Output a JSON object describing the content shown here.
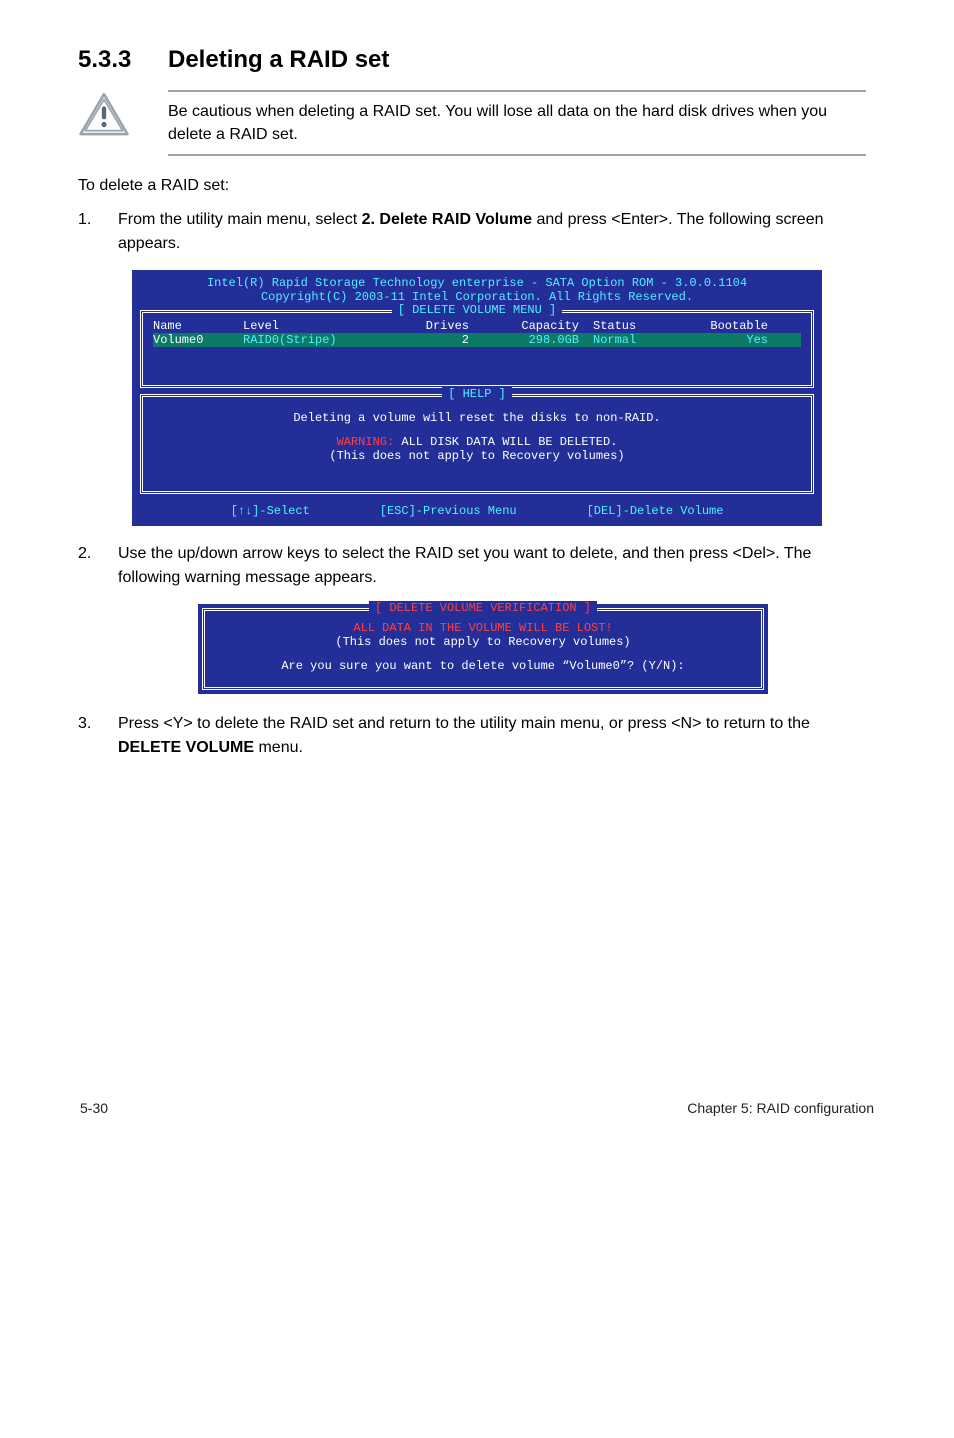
{
  "heading": {
    "number": "5.3.3",
    "title": "Deleting a RAID set"
  },
  "callout": "Be cautious when deleting a RAID set. You will lose all data on the hard disk drives when you delete a RAID set.",
  "intro": "To delete a RAID set:",
  "steps": {
    "1": {
      "num": "1.",
      "pre": "From the utility main menu, select ",
      "bold": "2. Delete RAID Volume",
      "post": " and press <Enter>. The following screen appears."
    },
    "2": {
      "num": "2.",
      "text": "Use the up/down arrow keys to select the RAID set you want to delete, and then press <Del>. The following warning message appears."
    },
    "3": {
      "num": "3.",
      "pre": "Press <Y> to delete the RAID set and return to the utility main menu, or press <N> to return to the ",
      "bold": "DELETE VOLUME",
      "post": " menu."
    }
  },
  "bios": {
    "header1": "Intel(R) Rapid Storage Technology enterprise - SATA Option ROM - 3.0.0.1104",
    "header2": "Copyright(C) 2003-11 Intel Corporation.  All Rights Reserved.",
    "box1": {
      "title": "[ DELETE VOLUME MENU ]",
      "cols": {
        "name": "Name",
        "level": "Level",
        "drives": "Drives",
        "capacity": "Capacity",
        "status": "Status",
        "bootable": "Bootable"
      },
      "row": {
        "name": "Volume0",
        "level": "RAID0(Stripe)",
        "drives": "2",
        "capacity": "298.0GB",
        "status": "Normal",
        "bootable": "Yes"
      }
    },
    "box2": {
      "title": "[ HELP ]",
      "line1": "Deleting a volume will reset the disks to non-RAID.",
      "warn": "WARNING:",
      "warn_rest": " ALL DISK DATA WILL BE DELETED.",
      "line3": "(This does not apply to Recovery volumes)"
    },
    "footer": {
      "a": "[↑↓]-Select",
      "b": "[ESC]-Previous Menu",
      "c": "[DEL]-Delete Volume"
    }
  },
  "dialog": {
    "title": "[ DELETE VOLUME VERIFICATION ]",
    "line1": "ALL DATA IN THE VOLUME WILL BE LOST!",
    "line2": "(This does not apply to Recovery volumes)",
    "line3": "Are you sure you want to delete volume “Volume0”? (Y/N):"
  },
  "footer": {
    "left": "5-30",
    "right": "Chapter 5: RAID configuration"
  }
}
